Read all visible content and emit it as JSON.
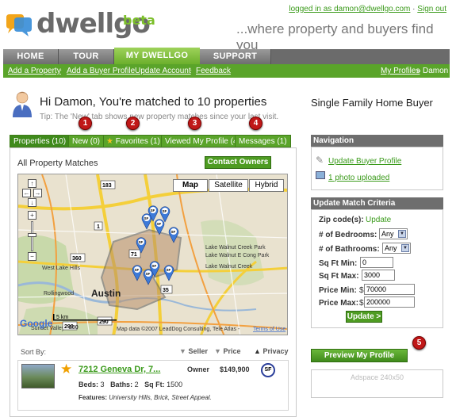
{
  "header": {
    "brand": "dwellgo",
    "brand_suffix": "beta",
    "tagline": "...where property and buyers find you",
    "logged_in_text": "logged in as damon@dwellgo.com",
    "separator": "·",
    "sign_out": "Sign out"
  },
  "nav": {
    "tabs": [
      {
        "label": "HOME",
        "active": false
      },
      {
        "label": "TOUR",
        "active": false
      },
      {
        "label": "MY DWELLGO",
        "active": true
      },
      {
        "label": "SUPPORT",
        "active": false
      }
    ]
  },
  "subnav": {
    "links": [
      "Add a Property",
      "Add a Buyer Profile",
      "Update Account",
      "Feedback"
    ],
    "breadcrumb_link": "My Profiles",
    "breadcrumb_sep": "»",
    "breadcrumb_current": "Damon"
  },
  "greeting": {
    "title": "Hi Damon, You're matched to 10 properties",
    "tip": "Tip: The 'New' tab shows new property matches since your last visit."
  },
  "badges": [
    "1",
    "2",
    "3",
    "4",
    "5"
  ],
  "property_tabs": [
    {
      "label": "Properties (10)",
      "active": true
    },
    {
      "label": "New (0)",
      "active": false
    },
    {
      "label": "Favorites (1)",
      "active": false
    },
    {
      "label": "Viewed My Profile (4)",
      "active": false
    },
    {
      "label": "Messages (1)",
      "active": false
    }
  ],
  "matches": {
    "title": "All Property Matches",
    "contact_button": "Contact Owners"
  },
  "map": {
    "types": [
      "Map",
      "Satellite",
      "Hybrid"
    ],
    "selected": "Map",
    "attribution": "Map data ©2007 LeadDog Consulting, Tele Atlas -",
    "terms": "Terms of Use",
    "scale_km": "5 km",
    "scale_ft": "290",
    "place_labels": [
      "Lake Walnut Creek Park",
      "Lake Walnut E Cong Park",
      "Lake Walnut Creek",
      "West Lake Hills",
      "Rollingwood",
      "Austin",
      "Sunset Valley"
    ],
    "road_labels": [
      "183",
      "1",
      "71",
      "290",
      "360",
      "35",
      "290"
    ],
    "pin_label": "SF",
    "pin_count": 10,
    "pan_glyphs": [
      "↑",
      "←",
      "→",
      "↓",
      "+",
      "−"
    ],
    "logo": "Google"
  },
  "sort": {
    "label": "Sort By:",
    "columns": [
      {
        "label": "Seller",
        "arrow": "▼"
      },
      {
        "label": "Price",
        "arrow": "▼"
      },
      {
        "label": "Privacy",
        "arrow": "▲"
      }
    ]
  },
  "listing": {
    "title": "7212 Geneva Dr, 7...",
    "seller": "Owner",
    "price": "$149,900",
    "type_badge": "SF",
    "beds_label": "Beds:",
    "beds": "3",
    "baths_label": "Baths:",
    "baths": "2",
    "sqft_label": "Sq Ft:",
    "sqft": "1500",
    "features_label": "Features:",
    "features": "University Hills, Brick, Street Appeal."
  },
  "profile": {
    "title": "Single Family Home Buyer"
  },
  "navigation_box": {
    "heading": "Navigation",
    "links": [
      "Update Buyer Profile",
      "1 photo uploaded"
    ]
  },
  "criteria": {
    "heading": "Update Match Criteria",
    "zip_label": "Zip code(s):",
    "zip_link": "Update",
    "bedrooms_label": "# of Bedrooms:",
    "bedrooms_value": "Any",
    "bathrooms_label": "# of Bathrooms:",
    "bathrooms_value": "Any",
    "sqft_min_label": "Sq Ft Min:",
    "sqft_min_value": "0",
    "sqft_max_label": "Sq Ft Max:",
    "sqft_max_value": "3000",
    "price_min_label": "Price Min:",
    "price_min_value": "70000",
    "price_max_label": "Price Max:",
    "price_max_value": "200000",
    "currency": "$",
    "update_button": "Update >"
  },
  "preview_button": "Preview My Profile",
  "adspace": "Adspace 240x50",
  "colors": {
    "brand_green": "#5aa42a",
    "nav_gray": "#6b6b6b",
    "badge_red": "#c01818",
    "link_green": "#3a9a1a"
  }
}
